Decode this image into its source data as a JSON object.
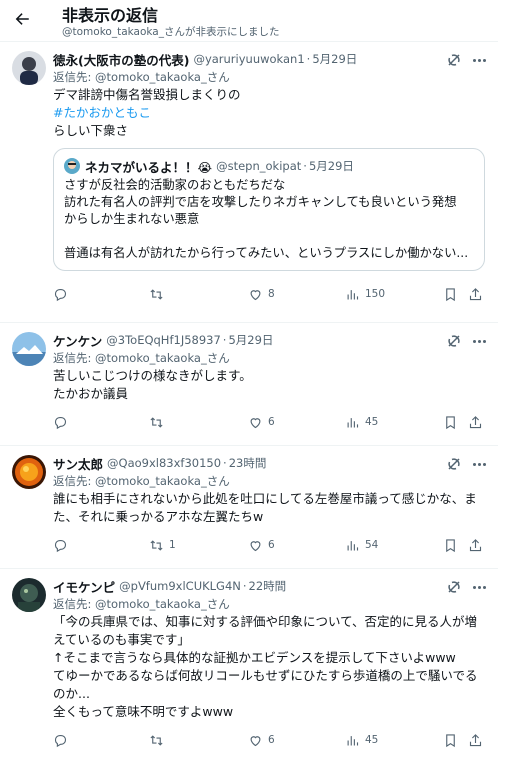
{
  "header": {
    "title": "非表示の返信",
    "subtitle": "@tomoko_takaoka_さんが非表示にしました"
  },
  "colors": {
    "accent": "#1d9bf0",
    "muted": "#536471",
    "border": "#eff3f4"
  },
  "tweets": [
    {
      "name": "徳永(大阪市の塾の代表)",
      "handle": "@yaruriyuuwokan1",
      "dot": "·",
      "date": "5月29日",
      "reply_label": "返信先:",
      "reply_handle": "@tomoko_takaoka_さん",
      "lines": [
        "デマ誹謗中傷名誉毀損しまくりの",
        "#たかおかともこ",
        "らしい下衆さ"
      ],
      "quote": {
        "name": "ネカマがいるよ！！😭",
        "handle": "@stepn_okipat",
        "dot": "·",
        "date": "5月29日",
        "lines": [
          "さすが反社会的活動家のおともだちだな",
          "訪れた有名人の評判で店を攻撃したりネガキャンしても良いという発想",
          "からしか生まれない悪意",
          "",
          "普通は有名人が訪れたから行ってみたい、というプラスにしか働かない..."
        ]
      },
      "stats": {
        "replies": "",
        "retweets": "",
        "likes": "8",
        "views": "150"
      }
    },
    {
      "name": "ケンケン",
      "handle": "@3ToEQqHf1J58937",
      "dot": "·",
      "date": "5月29日",
      "reply_label": "返信先:",
      "reply_handle": "@tomoko_takaoka_さん",
      "lines": [
        "苦しいこじつけの様なきがします。",
        "たかおか議員"
      ],
      "stats": {
        "replies": "",
        "retweets": "",
        "likes": "6",
        "views": "45"
      }
    },
    {
      "name": "サン太郎",
      "handle": "@Qao9xl83xf30150",
      "dot": "·",
      "date": "23時間",
      "reply_label": "返信先:",
      "reply_handle": "@tomoko_takaoka_さん",
      "lines": [
        "誰にも相手にされないから此処を吐口にしてる左巻屋市議って感じかな、ま",
        "た、それに乗っかるアホな左翼たちw"
      ],
      "stats": {
        "replies": "",
        "retweets": "1",
        "likes": "6",
        "views": "54"
      }
    },
    {
      "name": "イモケンピ",
      "handle": "@pVfum9xlCUKLG4N",
      "dot": "·",
      "date": "22時間",
      "reply_label": "返信先:",
      "reply_handle": "@tomoko_takaoka_さん",
      "lines": [
        "「今の兵庫県では、知事に対する評価や印象について、否定的に見る人が増",
        "えているのも事実です」",
        "↑そこまで言うなら具体的な証拠かエビデンスを提示して下さいよwww",
        "てゆーかであるならば何故リコールもせずにひたすら歩道橋の上で騒いでる",
        "のか...",
        "全くもって意味不明ですよwww"
      ],
      "stats": {
        "replies": "",
        "retweets": "",
        "likes": "6",
        "views": "45"
      }
    }
  ]
}
